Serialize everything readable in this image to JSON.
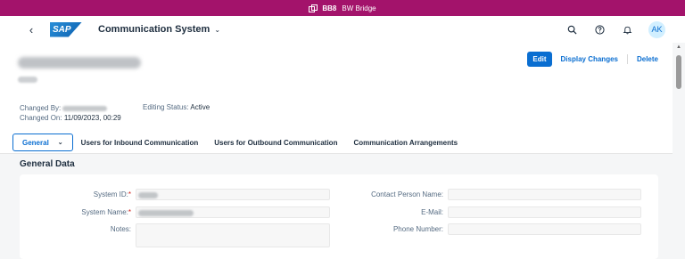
{
  "system_bar": {
    "system_id": "BB8",
    "system_name": "BW Bridge"
  },
  "shell": {
    "back_icon": "‹",
    "logo_text": "SAP",
    "app_title": "Communication System",
    "title_chevron": "⌄",
    "avatar_initials": "AK"
  },
  "object_header": {
    "actions": {
      "edit": "Edit",
      "display_changes": "Display Changes",
      "delete": "Delete"
    },
    "changed_by_label": "Changed By:",
    "changed_on_label": "Changed On:",
    "changed_on_value": "11/09/2023, 00:29",
    "editing_status_label": "Editing Status:",
    "editing_status_value": "Active"
  },
  "tabs": [
    {
      "label": "General",
      "chevron": "⌄"
    },
    {
      "label": "Users for Inbound Communication"
    },
    {
      "label": "Users for Outbound Communication"
    },
    {
      "label": "Communication Arrangements"
    }
  ],
  "section": {
    "title": "General Data"
  },
  "form": {
    "system_id_label": "System ID:",
    "system_name_label": "System Name:",
    "notes_label": "Notes:",
    "contact_person_label": "Contact Person Name:",
    "email_label": "E-Mail:",
    "phone_label": "Phone Number:",
    "required_mark": "*"
  },
  "colors": {
    "system_bar": "#a3136b",
    "accent": "#0a6ed1",
    "required": "#d0201a"
  }
}
